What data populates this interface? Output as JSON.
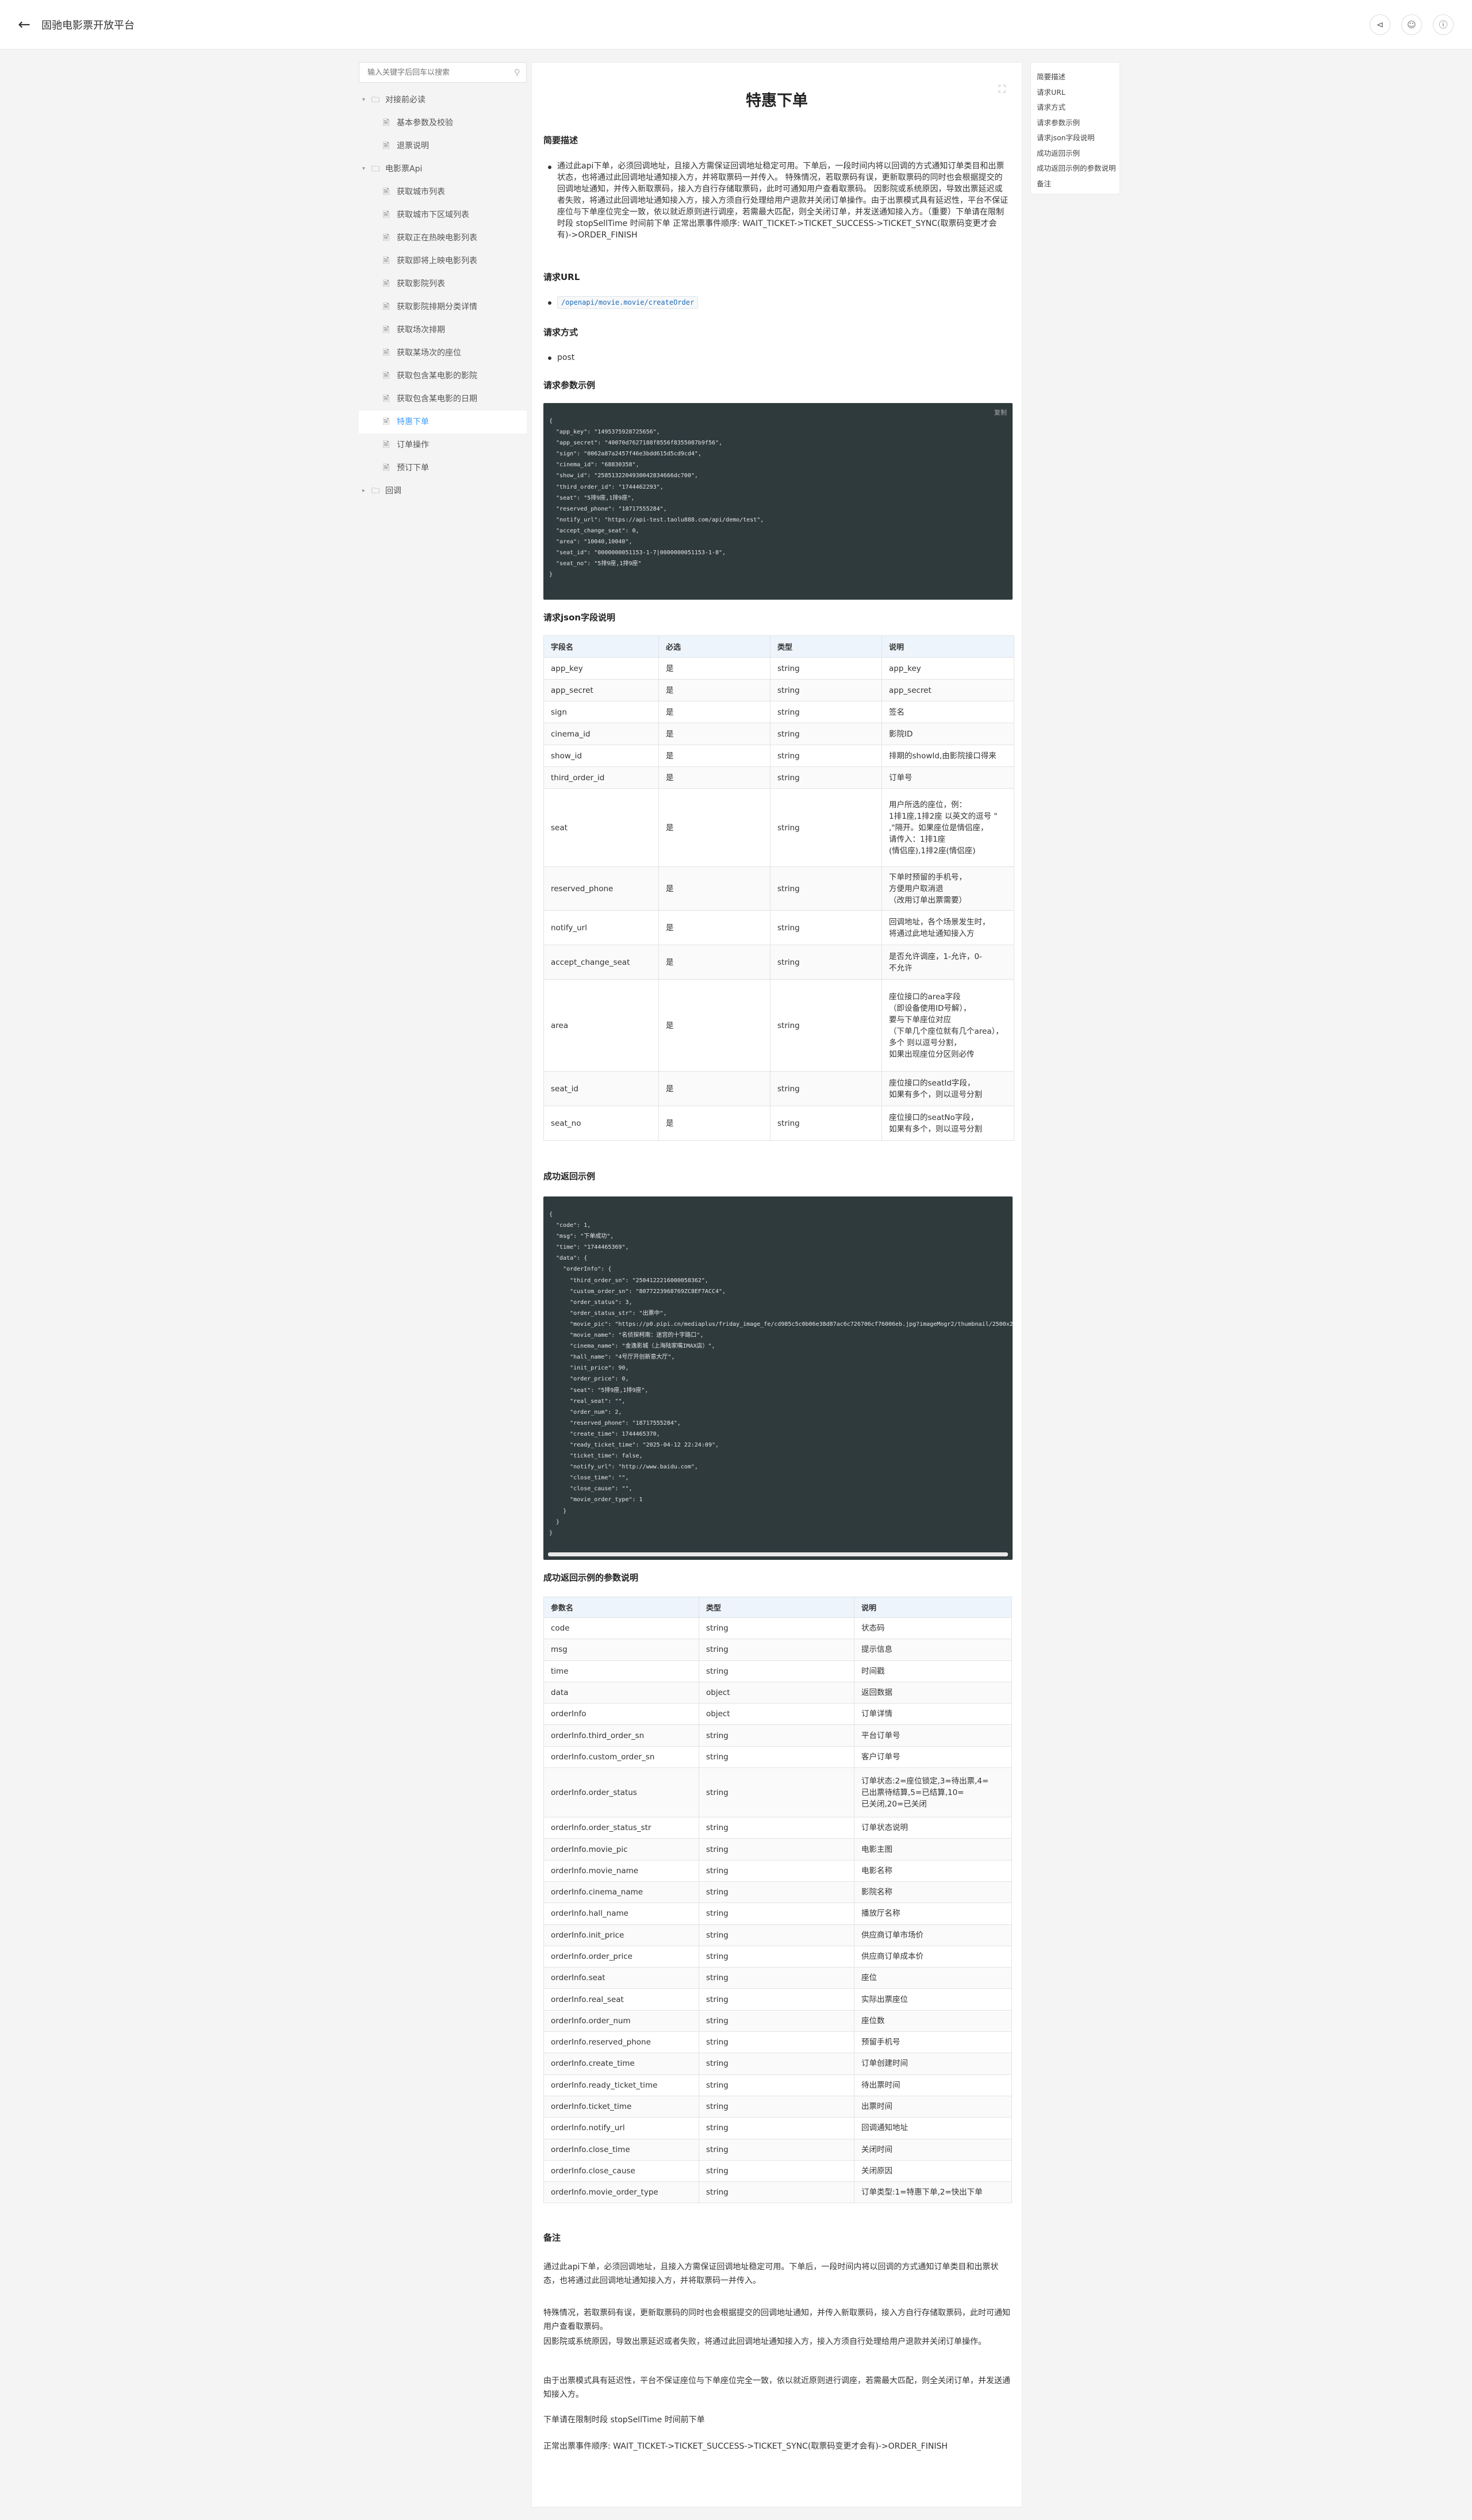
{
  "header": {
    "title": "固驰电影票开放平台",
    "back_icon": "arrow-left-icon",
    "actions": [
      "share-icon",
      "user-icon",
      "info-icon"
    ]
  },
  "search": {
    "placeholder": "输入关键字后回车以搜索"
  },
  "tree": [
    {
      "label": "对接前必读",
      "level": 0,
      "type": "folder",
      "open": true
    },
    {
      "label": "基本参数及校验",
      "level": 1,
      "type": "file"
    },
    {
      "label": "退票说明",
      "level": 1,
      "type": "file"
    },
    {
      "label": "电影票Api",
      "level": 0,
      "type": "folder",
      "open": true
    },
    {
      "label": "获取城市列表",
      "level": 1,
      "type": "file"
    },
    {
      "label": "获取城市下区域列表",
      "level": 1,
      "type": "file"
    },
    {
      "label": "获取正在热映电影列表",
      "level": 1,
      "type": "file"
    },
    {
      "label": "获取即将上映电影列表",
      "level": 1,
      "type": "file"
    },
    {
      "label": "获取影院列表",
      "level": 1,
      "type": "file"
    },
    {
      "label": "获取影院排期分类详情",
      "level": 1,
      "type": "file"
    },
    {
      "label": "获取场次排期",
      "level": 1,
      "type": "file"
    },
    {
      "label": "获取某场次的座位",
      "level": 1,
      "type": "file"
    },
    {
      "label": "获取包含某电影的影院",
      "level": 1,
      "type": "file"
    },
    {
      "label": "获取包含某电影的日期",
      "level": 1,
      "type": "file"
    },
    {
      "label": "特惠下单",
      "level": 1,
      "type": "file",
      "active": true
    },
    {
      "label": "订单操作",
      "level": 1,
      "type": "file"
    },
    {
      "label": "预订下单",
      "level": 1,
      "type": "file"
    },
    {
      "label": "回调",
      "level": 0,
      "type": "folder",
      "open": false
    }
  ],
  "doc": {
    "title": "特惠下单",
    "expand_icon": "fullscreen-icon",
    "sections": {
      "desc": "简要描述",
      "url": "请求URL",
      "method": "请求方式",
      "req_example": "请求参数示例",
      "req_fields": "请求json字段说明",
      "resp_example": "成功返回示例",
      "resp_fields": "成功返回示例的参数说明",
      "notes": "备注"
    },
    "desc_text": "通过此api下单，必须回调地址，且接入方需保证回调地址稳定可用。下单后，一段时间内将以回调的方式通知订单类目和出票状态，也将通过此回调地址通知接入方，并将取票码一并传入。 特殊情况，若取票码有误，更新取票码的同时也会根据提交的回调地址通知，并传入新取票码，接入方自行存储取票码，此时可通知用户查看取票码。 因影院或系统原因，导致出票延迟或者失败，将通过此回调地址通知接入方，接入方须自行处理给用户退款并关闭订单操作。由于出票模式具有延迟性，平台不保证座位与下单座位完全一致，依以就近原则进行调座，若需最大匹配，则全关闭订单，并发送通知接入方。（重要）下单请在限制时段 stopSellTime 时间前下单 正常出票事件顺序: WAIT_TICKET->TICKET_SUCCESS->TICKET_SYNC(取票码变更才会有)->ORDER_FINISH",
    "url": "/openapi/movie.movie/createOrder",
    "method": "post",
    "copy_label": "复制",
    "request_json": "{\n  \"app_key\": \"1495375928725656\",\n  \"app_secret\": \"40070d7627188f8556f8355087b9f56\",\n  \"sign\": \"0062a87a2457f46e3bdd615d5cd9cd4\",\n  \"cinema_id\": \"68830358\",\n  \"show_id\": \"2585132204930042834666dc700\",\n  \"third_order_id\": \"1744462293\",\n  \"seat\": \"5排9座,1排9座\",\n  \"reserved_phone\": \"18717555284\",\n  \"notify_url\": \"https://api-test.taolu888.com/api/demo/test\",\n  \"accept_change_seat\": 0,\n  \"area\": \"10040,10040\",\n  \"seat_id\": \"0000000051153-1-7|0000000051153-1-8\",\n  \"seat_no\": \"5排9座,1排9座\"\n}",
    "req_columns": [
      "字段名",
      "必选",
      "类型",
      "说明"
    ],
    "req_rows": [
      [
        "app_key",
        "是",
        "string",
        "app_key"
      ],
      [
        "app_secret",
        "是",
        "string",
        "app_secret"
      ],
      [
        "sign",
        "是",
        "string",
        "签名"
      ],
      [
        "cinema_id",
        "是",
        "string",
        "影院ID"
      ],
      [
        "show_id",
        "是",
        "string",
        "排期的showId,由影院接口得来"
      ],
      [
        "third_order_id",
        "是",
        "string",
        "订单号"
      ],
      [
        "seat",
        "是",
        "string",
        "用户所选的座位，例：\n1排1座,1排2座 以英文的逗号 \"\n,\"隔开。如果座位是情侣座，\n请传入：1排1座\n(情侣座),1排2座(情侣座)"
      ],
      [
        "reserved_phone",
        "是",
        "string",
        "下单时预留的手机号，\n方便用户取消退\n（改用订单出票需要）"
      ],
      [
        "notify_url",
        "是",
        "string",
        "回调地址，各个场景发生时，\n将通过此地址通知接入方"
      ],
      [
        "accept_change_seat",
        "是",
        "string",
        "是否允许调座，1-允许，0-\n不允许"
      ],
      [
        "area",
        "是",
        "string",
        "座位接口的area字段\n（即设备使用ID号解），\n要与下单座位对应\n（下单几个座位就有几个area），\n多个 则以逗号分割，\n如果出现座位分区则必传"
      ],
      [
        "seat_id",
        "是",
        "string",
        "座位接口的seatId字段，\n如果有多个，则以逗号分割"
      ],
      [
        "seat_no",
        "是",
        "string",
        "座位接口的seatNo字段，\n如果有多个，则以逗号分割"
      ]
    ],
    "response_json": "{\n  \"code\": 1,\n  \"msg\": \"下单成功\",\n  \"time\": \"1744465369\",\n  \"data\": {\n    \"orderInfo\": {\n      \"third_order_sn\": \"2504122216000058362\",\n      \"custom_order_sn\": \"8077223968769ZC8EF7ACC4\",\n      \"order_status\": 3,\n      \"order_status_str\": \"出票中\",\n      \"movie_pic\": \"https://p0.pipi.cn/mediaplus/friday_image_fe/cd985c5c0b06e38d87ac6c726706cf76006eb.jpg?imageMogr2/thumbnail/2500x2500%3E\",\n      \"movie_name\": \"名侦探柯南：迷宫的十字路口\",\n      \"cinema_name\": \"金逸影城（上海陆家嘴IMAX店）\",\n      \"hall_name\": \"4号厅开创新意大厅\",\n      \"init_price\": 90,\n      \"order_price\": 0,\n      \"seat\": \"5排9座,1排9座\",\n      \"real_seat\": \"\",\n      \"order_num\": 2,\n      \"reserved_phone\": \"18717555284\",\n      \"create_time\": 1744465370,\n      \"ready_ticket_time\": \"2025-04-12 22:24:09\",\n      \"ticket_time\": false,\n      \"notify_url\": \"http://www.baidu.com\",\n      \"close_time\": \"\",\n      \"close_cause\": \"\",\n      \"movie_order_type\": 1\n    }\n  }\n}",
    "resp_columns": [
      "参数名",
      "类型",
      "说明"
    ],
    "resp_rows": [
      [
        "code",
        "string",
        "状态码"
      ],
      [
        "msg",
        "string",
        "提示信息"
      ],
      [
        "time",
        "string",
        "时间戳"
      ],
      [
        "data",
        "object",
        "返回数据"
      ],
      [
        "orderInfo",
        "object",
        "订单详情"
      ],
      [
        "orderInfo.third_order_sn",
        "string",
        "平台订单号"
      ],
      [
        "orderInfo.custom_order_sn",
        "string",
        "客户订单号"
      ],
      [
        "orderInfo.order_status",
        "string",
        "订单状态:2=座位锁定,3=待出票,4=\n已出票待结算,5=已结算,10=\n已关闭,20=已关闭"
      ],
      [
        "orderInfo.order_status_str",
        "string",
        "订单状态说明"
      ],
      [
        "orderInfo.movie_pic",
        "string",
        "电影主图"
      ],
      [
        "orderInfo.movie_name",
        "string",
        "电影名称"
      ],
      [
        "orderInfo.cinema_name",
        "string",
        "影院名称"
      ],
      [
        "orderInfo.hall_name",
        "string",
        "播放厅名称"
      ],
      [
        "orderInfo.init_price",
        "string",
        "供应商订单市场价"
      ],
      [
        "orderInfo.order_price",
        "string",
        "供应商订单成本价"
      ],
      [
        "orderInfo.seat",
        "string",
        "座位"
      ],
      [
        "orderInfo.real_seat",
        "string",
        "实际出票座位"
      ],
      [
        "orderInfo.order_num",
        "string",
        "座位数"
      ],
      [
        "orderInfo.reserved_phone",
        "string",
        "预留手机号"
      ],
      [
        "orderInfo.create_time",
        "string",
        "订单创建时间"
      ],
      [
        "orderInfo.ready_ticket_time",
        "string",
        "待出票时间"
      ],
      [
        "orderInfo.ticket_time",
        "string",
        "出票时间"
      ],
      [
        "orderInfo.notify_url",
        "string",
        "回调通知地址"
      ],
      [
        "orderInfo.close_time",
        "string",
        "关闭时间"
      ],
      [
        "orderInfo.close_cause",
        "string",
        "关闭原因"
      ],
      [
        "orderInfo.movie_order_type",
        "string",
        "订单类型:1=特惠下单,2=快出下单"
      ]
    ],
    "notes": [
      "通过此api下单，必须回调地址，且接入方需保证回调地址稳定可用。下单后，一段时间内将以回调的方式通知订单类目和出票状态，也将通过此回调地址通知接入方，并将取票码一并传入。",
      "特殊情况，若取票码有误，更新取票码的同时也会根据提交的回调地址通知，并传入新取票码，接入方自行存储取票码，此时可通知用户查看取票码。",
      "因影院或系统原因，导致出票延迟或者失败，将通过此回调地址通知接入方，接入方须自行处理给用户退款并关闭订单操作。",
      "由于出票模式具有延迟性，平台不保证座位与下单座位完全一致，依以就近原则进行调座，若需最大匹配，则全关闭订单，并发送通知接入方。",
      "下单请在限制时段 stopSellTime 时间前下单",
      "正常出票事件顺序: WAIT_TICKET->TICKET_SUCCESS->TICKET_SYNC(取票码变更才会有)->ORDER_FINISH"
    ]
  },
  "toc": [
    "简要描述",
    "请求URL",
    "请求方式",
    "请求参数示例",
    "请求json字段说明",
    "成功返回示例",
    "成功返回示例的参数说明",
    "备注"
  ]
}
